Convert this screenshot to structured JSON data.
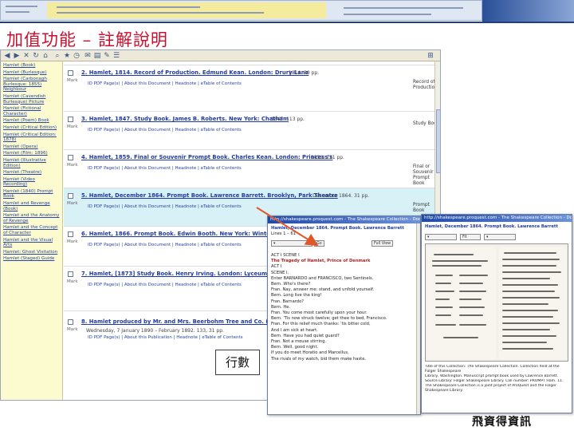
{
  "slide": {
    "title": "加值功能 – 註解說明",
    "callout": "行數",
    "footer": "飛資得資訊"
  },
  "colors": {
    "title": "#c8102e",
    "link": "#2a44a8",
    "sidebar_bg": "#fbfbcf",
    "highlight_row": "#d7f1f6",
    "arrow": "#e0582a"
  },
  "sidebar": {
    "items": [
      "Hamlet (Book)",
      "Hamlet (Burlesque)",
      "Hamlet (Carbonagh Burlesque: 1855) Neighbour",
      "Hamlet (Cavendish Burlesque) Picture",
      "Hamlet (Fictional Character)",
      "Hamlet (Poem) Book",
      "Hamlet (Critical Edition)",
      "Hamlet (Critical Edition: 1878)",
      "Hamlet (Opera)",
      "Hamlet (Film: 1896)",
      "Hamlet (Illustrative Edition)",
      "Hamlet (Theatre)",
      "Hamlet (Video Recording)",
      "Hamlet (1840) Prompt Book",
      "Hamlet and Revenge (Book)",
      "Hamlet and the Anatomy of Revenge",
      "Hamlet and the Concept of Character",
      "Hamlet and the Visual Arts",
      "Hamlet: Ghost Visitation",
      "Hamlet (Staged) Guide"
    ]
  },
  "results": [
    {
      "number": "2.",
      "title": "Hamlet, 1814. Record of Production. Edmund Kean. London: Drury Lane",
      "meta": "1814. 30 pp.",
      "links": "ID PDF Page(s)  |  About this Document  |  Headnote  |  eTable of Contents",
      "type": "Record of Production"
    },
    {
      "number": "3.",
      "title": "Hamlet, 1847. Study Book. James B. Roberts. New York: Chatham",
      "meta": "1847. 113 pp.",
      "links": "ID PDF Page(s)  |  About this Document  |  Headnote  |  eTable of Contents",
      "type": "Study Book"
    },
    {
      "number": "4.",
      "title": "Hamlet, 1859. Final or Souvenir Prompt Book. Charles Kean. London: Princess's",
      "meta": "1859. 121 pp.",
      "links": "ID PDF Page(s)  |  About this Document  |  Headnote  |  eTable of Contents",
      "type": "Final or Souvenir Prompt Book"
    },
    {
      "number": "5.",
      "title": "Hamlet, December 1864. Prompt Book. Lawrence Barrett. Brooklyn, Park Theatre",
      "meta": "December 1864. 31 pp.",
      "links": "ID PDF Page(s)  |  About this Document  |  Headnote  |  eTable of Contents",
      "type": "Prompt Book"
    },
    {
      "number": "6.",
      "title": "Hamlet, 1866. Prompt Book. Edwin Booth. New York: Winter Garden",
      "meta": "",
      "links": "ID PDF Page(s)  |  About this Document  |  Headnote  |  eTable of Contents",
      "type": ""
    },
    {
      "number": "7.",
      "title": "Hamlet, [1873] Study Book. Henry Irving. London: Lyceum Theatre",
      "meta": "",
      "links": "ID PDF Page(s)  |  About this Document  |  Headnote  |  eTable of Contents",
      "type": ""
    },
    {
      "number": "8.",
      "title": "Hamlet produced by Mr. and Mrs. Beerbohm Tree and Co. (April 1",
      "meta": "Wednesday, 7 January 1890 – February 1892. 133, 31 pp.",
      "links": "ID PDF Page(s)  |  About this Publication  |  Headnote  |  eTable of Contents",
      "type": ""
    }
  ],
  "popup_left": {
    "title": "http://shakespeare.proquest.com - The Shakespeare Collection - Document",
    "line1": "Hamlet, December 1864. Prompt Book. Lawrence Barrett",
    "line2": "Lines  1 – 61",
    "button_go": "Go",
    "button_zoom": "Full View",
    "text": [
      "ACT I SCENE I",
      "The Tragedy of Hamlet, Prince of Denmark",
      "ACT I",
      "SCENE I.",
      "Enter BARNARDO and FRANCISCO, two Sentinels.",
      "Bern. Who's there?",
      "Fran. Nay, answer me: stand, and unfold yourself.",
      "Bern. Long live the king!",
      "Fran. Barnardo?",
      "Bern. He.",
      "Fran. You come most carefully upon your hour.",
      "Bern. 'Tis now struck twelve; get thee to bed, Francisco.",
      "Fran. For this relief much thanks: 'tis bitter cold,",
      "And I am sick at heart.",
      "Bern. Have you had quiet guard?",
      "Fran. Not a mouse stirring.",
      "Bern. Well, good night.",
      "If you do meet Horatio and Marcellus,",
      "The rivals of my watch, bid them make haste."
    ]
  },
  "popup_right": {
    "title": "http://shakespeare.proquest.com - The Shakespeare Collection - Document",
    "line1": "Hamlet, December 1864. Prompt Book. Lawrence Barrett",
    "zoom": "Fit",
    "caption": [
      "Title of this Collection: The Shakespeare Collection. Collection held at the Folger Shakespeare",
      "Library, Washington. Manuscript prompt book used by Lawrence Barrett.",
      "Source Library: Folger Shakespeare Library. Call number: PROMPT Ham. 11.",
      "The Shakespeare Collection is a joint project of ProQuest and the Folger Shakespeare Library."
    ]
  }
}
